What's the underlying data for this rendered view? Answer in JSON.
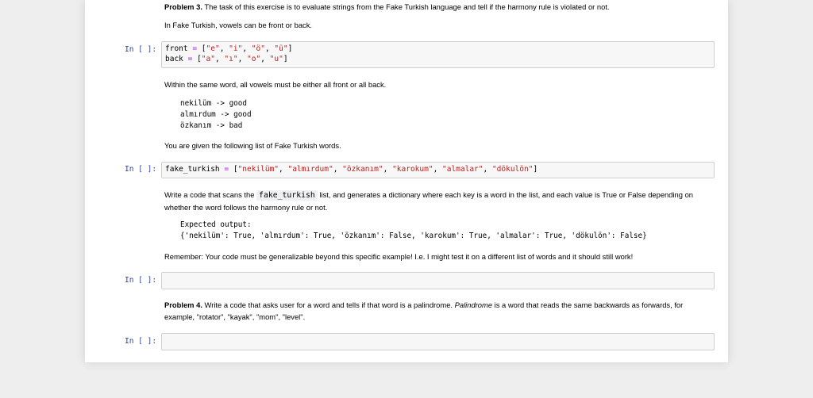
{
  "problem3": {
    "heading": "Problem 3.",
    "intro": " The task of this exercise is to evaluate strings from the Fake Turkish language and tell if the harmony rule is violated or not.",
    "vowels_text": "In Fake Turkish, vowels can be front or back.",
    "cell1": {
      "prompt": "In [ ]:",
      "line1": {
        "var": "front",
        "op": "=",
        "values": [
          "e",
          "i",
          "ö",
          "ü"
        ]
      },
      "line2": {
        "var": "back",
        "op": "=",
        "values": [
          "a",
          "ı",
          "o",
          "u"
        ]
      }
    },
    "rule_text": "Within the same word, all vowels must be either all front or all back.",
    "examples": [
      "nekilüm -> good",
      "almırdum -> good",
      "özkanım -> bad"
    ],
    "given_text": "You are given the following list of Fake Turkish words.",
    "cell2": {
      "prompt": "In [ ]:",
      "var": "fake_turkish",
      "op": "=",
      "values": [
        "nekilüm",
        "almırdum",
        "özkanım",
        "karokum",
        "almalar",
        "dökulön"
      ]
    },
    "task_before": "Write a code that scans the ",
    "task_code": "fake_turkish",
    "task_after": " list, and generates a dictionary where each key is a word in the list, and each value is True or False depending on whether the word follows the harmony rule or not.",
    "expected_label": "Expected output:",
    "expected_value": "{'nekilüm': True, 'almırdum': True, 'özkanım': False, 'karokum': True, 'almalar': True, 'dökulön': False}",
    "remember_text": "Remember: Your code must be generalizable beyond this specific example! I.e. I might test it on a different list of words and it should still work!",
    "cell3": {
      "prompt": "In [ ]:",
      "value": ""
    }
  },
  "problem4": {
    "heading": "Problem 4.",
    "text_before": " Write a code that asks user for a word and tells if that word is a palindrome. ",
    "italic": "Palindrome",
    "text_after": " is a word that reads the same backwards as forwards, for example, \"rotator\", \"kayak\", \"mom\", \"level\".",
    "cell4": {
      "prompt": "In [ ]:",
      "value": ""
    }
  },
  "colors": {
    "prompt": "#303f9f",
    "string": "#ba2121",
    "operator": "#aa22ff",
    "cell_bg": "#f7f7f7",
    "page_bg": "#eeeeee"
  }
}
